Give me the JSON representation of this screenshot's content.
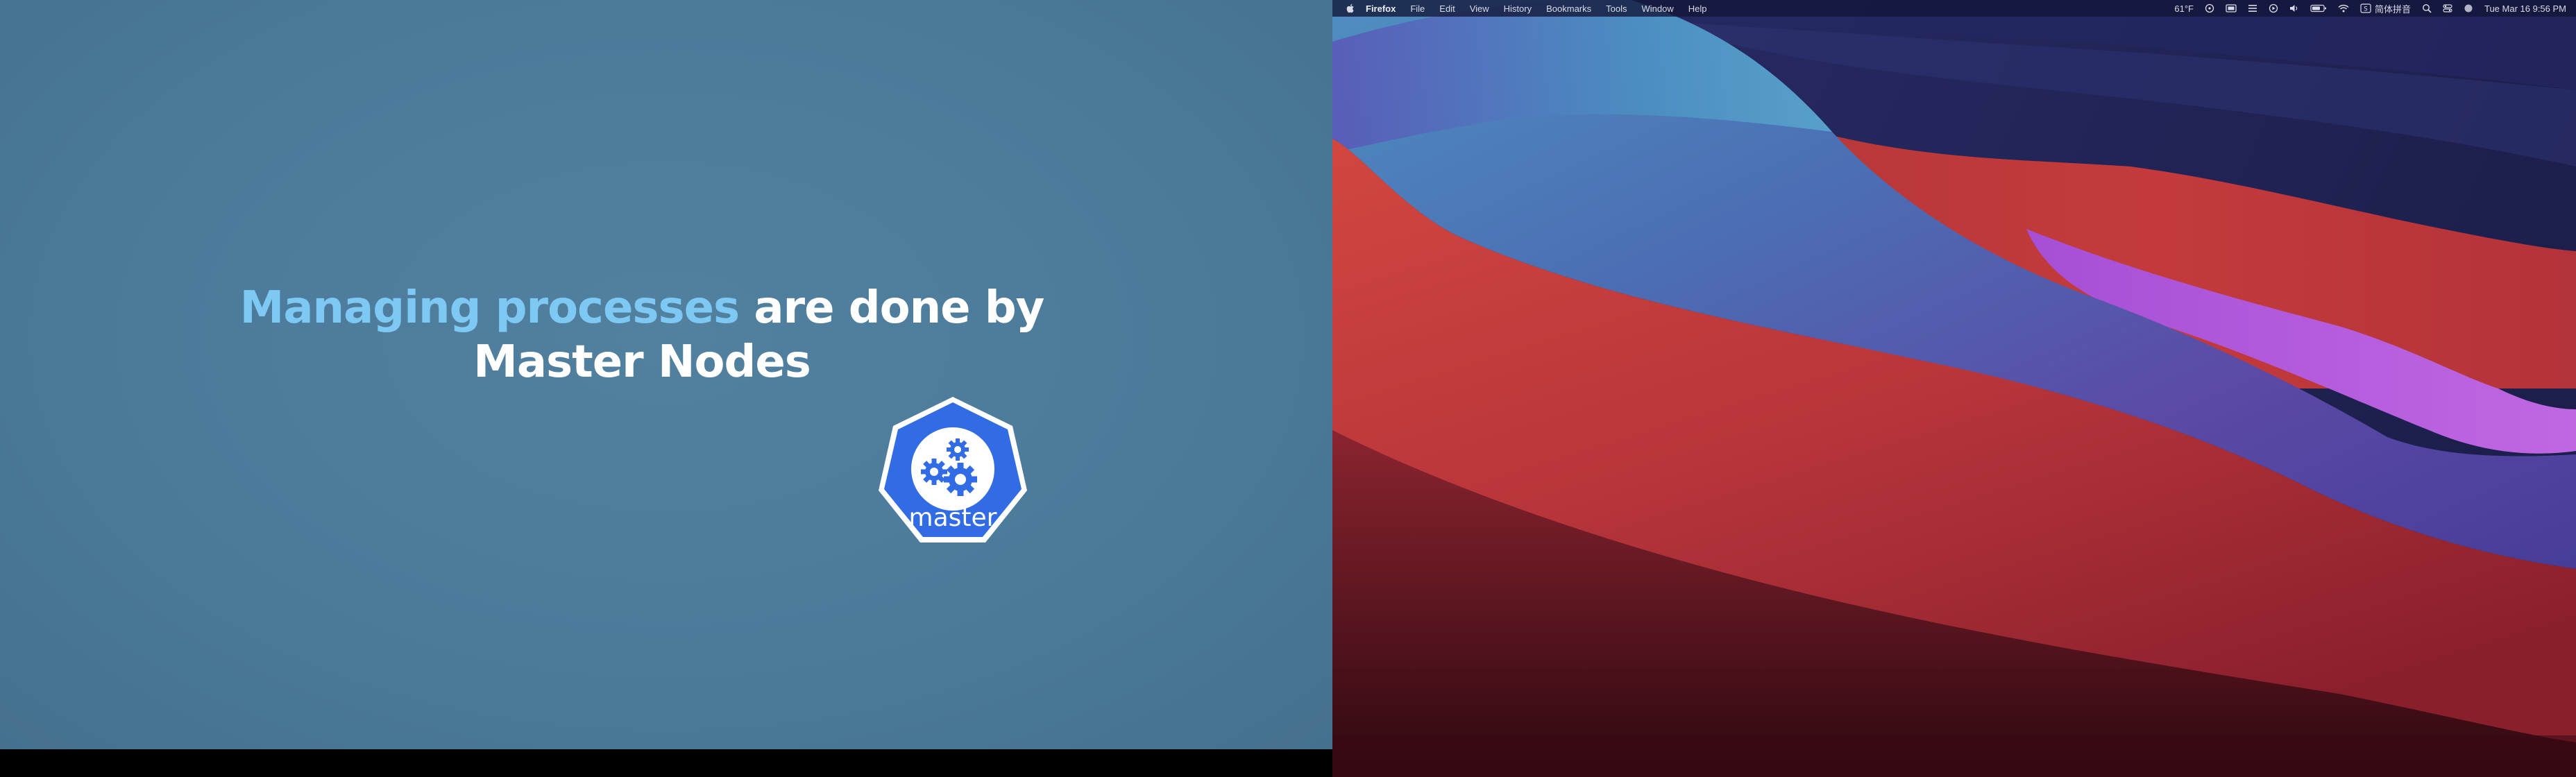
{
  "slide": {
    "heading_highlight": "Managing processes",
    "heading_rest": " are done by",
    "heading_line2": "Master Nodes",
    "logo_label": "master",
    "colors": {
      "background": "#4b7a9b",
      "highlight_text": "#7ec8f4",
      "text": "#ffffff",
      "logo_fill": "#326ce5"
    }
  },
  "menubar": {
    "app_name": "Firefox",
    "menus": [
      "File",
      "Edit",
      "View",
      "History",
      "Bookmarks",
      "Tools",
      "Window",
      "Help"
    ],
    "status": {
      "temperature": "61°F",
      "input_method": "简体拼音",
      "datetime": "Tue Mar 16  9:56 PM"
    }
  },
  "icons": {
    "apple": "apple-icon",
    "logo": "kubernetes-master-icon"
  }
}
